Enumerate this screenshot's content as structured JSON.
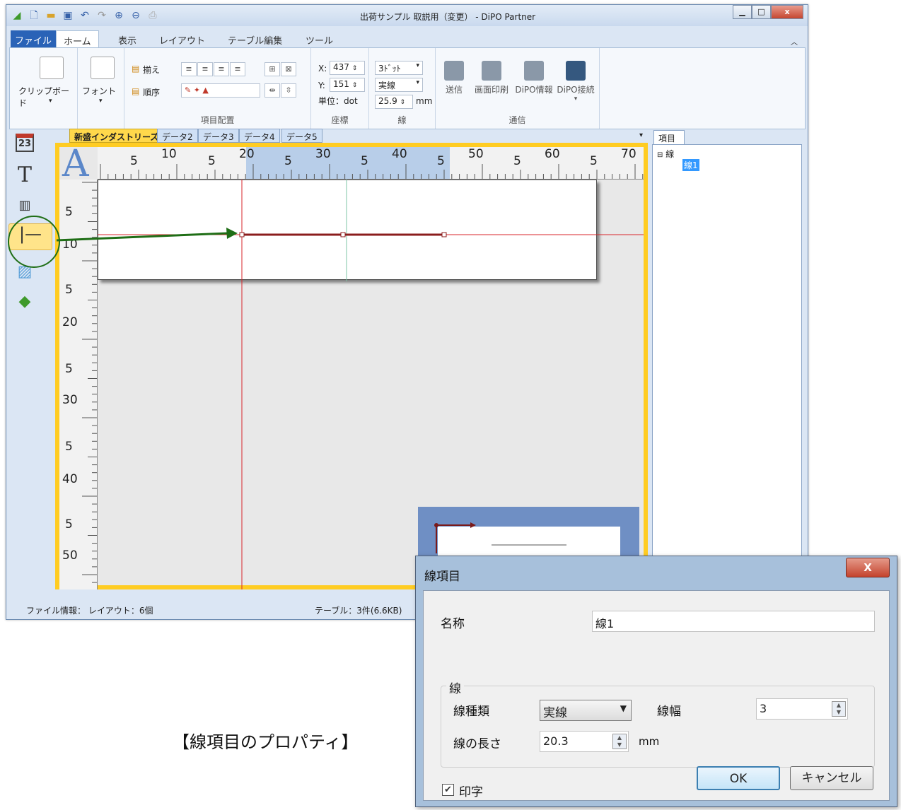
{
  "window": {
    "title": "出荷サンプル  取説用（変更） - DiPO Partner"
  },
  "ribbon": {
    "tabs": [
      "ファイル",
      "ホーム",
      "表示",
      "レイアウト",
      "テーブル編集",
      "ツール"
    ],
    "clipboard_label": "クリップボード",
    "font_label": "フォント",
    "align_label": "揃え",
    "order_label": "順序",
    "layout_group_label": "項目配置",
    "x_label": "X:",
    "x_value": "437",
    "y_label": "Y:",
    "y_value": "151",
    "unit_label": "単位：dot",
    "coord_group_label": "座標",
    "line_width_select": "3ﾄﾞｯﾄ",
    "line_type_select": "実線",
    "line_length_value": "25.9",
    "line_length_unit": "mm",
    "line_group_label": "線",
    "send_label": "送信",
    "screen_print_label": "画面印刷",
    "dipo_info_label": "DiPO情報",
    "dipo_connect_label": "DiPO接続",
    "comm_group_label": "通信"
  },
  "document": {
    "tabs": [
      "新盛インダストリーズ",
      "データ2",
      "データ3",
      "データ4",
      "データ5"
    ],
    "ruler_top_numbers": [
      "5",
      "10",
      "5",
      "20",
      "5",
      "30",
      "5",
      "40",
      "5",
      "50",
      "5",
      "60",
      "5",
      "70"
    ],
    "ruler_left_numbers": [
      "5",
      "10",
      "5",
      "20",
      "5",
      "30",
      "5",
      "40",
      "5",
      "50"
    ]
  },
  "tree": {
    "tab_label": "項目",
    "root_label": "線",
    "child_label": "線1"
  },
  "status": {
    "file_info": "ファイル情報：  レイアウト：6個",
    "table_info": "テーブル：3件(6.6KB)"
  },
  "dialog": {
    "title": "線項目",
    "name_label": "名称",
    "name_value": "線1",
    "group_label": "線",
    "line_type_label": "線種類",
    "line_type_value": "実線",
    "line_width_label": "線幅",
    "line_width_value": "3",
    "line_length_label": "線の長さ",
    "line_length_value": "20.3",
    "line_length_unit": "mm",
    "print_label": "印字",
    "print_checked": true,
    "ok_label": "OK",
    "cancel_label": "キャンセル"
  },
  "caption": "【線項目のプロパティ】",
  "colors": {
    "accent": "#ffcc22",
    "arrow": "#1f6e16",
    "guide": "#d9262b"
  }
}
